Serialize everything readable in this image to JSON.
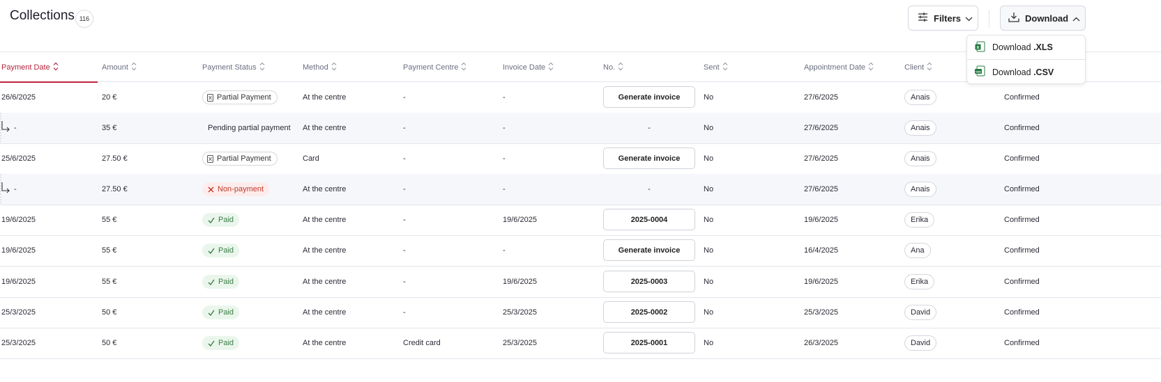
{
  "header": {
    "title": "Collections",
    "count": "116"
  },
  "toolbar": {
    "filters_label": "Filters",
    "download_label": "Download"
  },
  "download_menu": {
    "items": [
      {
        "prefix": "Download ",
        "ext": ".XLS",
        "icon": "excel-icon"
      },
      {
        "prefix": "Download ",
        "ext": ".CSV",
        "icon": "csv-icon"
      }
    ]
  },
  "columns": [
    "Payment Date",
    "Amount",
    "Payment Status",
    "Method",
    "Payment Centre",
    "Invoice Date",
    "No.",
    "Sent",
    "Appointment Date",
    "Client"
  ],
  "rows": [
    {
      "sub": false,
      "payment_date": "26/6/2025",
      "amount": "20 €",
      "status": "Partial Payment",
      "status_type": "partial",
      "method": "At the centre",
      "centre": "-",
      "invoice_date": "-",
      "number": "Generate invoice",
      "number_type": "button",
      "sent": "No",
      "appointment_date": "27/6/2025",
      "client": "Anais",
      "state": "Confirmed"
    },
    {
      "sub": true,
      "payment_date": "-",
      "amount": "35 €",
      "status": "Pending partial payment",
      "status_type": "text",
      "method": "At the centre",
      "centre": "-",
      "invoice_date": "-",
      "number": "-",
      "number_type": "text",
      "sent": "No",
      "appointment_date": "27/6/2025",
      "client": "Anais",
      "state": "Confirmed"
    },
    {
      "sub": false,
      "payment_date": "25/6/2025",
      "amount": "27.50 €",
      "status": "Partial Payment",
      "status_type": "partial",
      "method": "Card",
      "centre": "-",
      "invoice_date": "-",
      "number": "Generate invoice",
      "number_type": "button",
      "sent": "No",
      "appointment_date": "27/6/2025",
      "client": "Anais",
      "state": "Confirmed"
    },
    {
      "sub": true,
      "payment_date": "-",
      "amount": "27.50 €",
      "status": "Non-payment",
      "status_type": "nonpay",
      "method": "At the centre",
      "centre": "-",
      "invoice_date": "-",
      "number": "-",
      "number_type": "text",
      "sent": "No",
      "appointment_date": "27/6/2025",
      "client": "Anais",
      "state": "Confirmed"
    },
    {
      "sub": false,
      "payment_date": "19/6/2025",
      "amount": "55 €",
      "status": "Paid",
      "status_type": "paid",
      "method": "At the centre",
      "centre": "-",
      "invoice_date": "19/6/2025",
      "number": "2025-0004",
      "number_type": "button",
      "sent": "No",
      "appointment_date": "19/6/2025",
      "client": "Erika",
      "state": "Confirmed"
    },
    {
      "sub": false,
      "payment_date": "19/6/2025",
      "amount": "55 €",
      "status": "Paid",
      "status_type": "paid",
      "method": "At the centre",
      "centre": "-",
      "invoice_date": "-",
      "number": "Generate invoice",
      "number_type": "button",
      "sent": "No",
      "appointment_date": "16/4/2025",
      "client": "Ana",
      "state": "Confirmed"
    },
    {
      "sub": false,
      "payment_date": "19/6/2025",
      "amount": "55 €",
      "status": "Paid",
      "status_type": "paid",
      "method": "At the centre",
      "centre": "-",
      "invoice_date": "19/6/2025",
      "number": "2025-0003",
      "number_type": "button",
      "sent": "No",
      "appointment_date": "19/6/2025",
      "client": "Erika",
      "state": "Confirmed"
    },
    {
      "sub": false,
      "payment_date": "25/3/2025",
      "amount": "50 €",
      "status": "Paid",
      "status_type": "paid",
      "method": "At the centre",
      "centre": "-",
      "invoice_date": "25/3/2025",
      "number": "2025-0002",
      "number_type": "button",
      "sent": "No",
      "appointment_date": "25/3/2025",
      "client": "David",
      "state": "Confirmed"
    },
    {
      "sub": false,
      "payment_date": "25/3/2025",
      "amount": "50 €",
      "status": "Paid",
      "status_type": "paid",
      "method": "At the centre",
      "centre": "Credit card",
      "invoice_date": "25/3/2025",
      "number": "2025-0001",
      "number_type": "button",
      "sent": "No",
      "appointment_date": "26/3/2025",
      "client": "David",
      "state": "Confirmed"
    }
  ],
  "colors": {
    "accent": "#c0233e",
    "paid_bg": "#eaf6ec",
    "paid_fg": "#3b7d46",
    "nonpay_bg": "#fdeceb",
    "nonpay_fg": "#c0392b"
  }
}
